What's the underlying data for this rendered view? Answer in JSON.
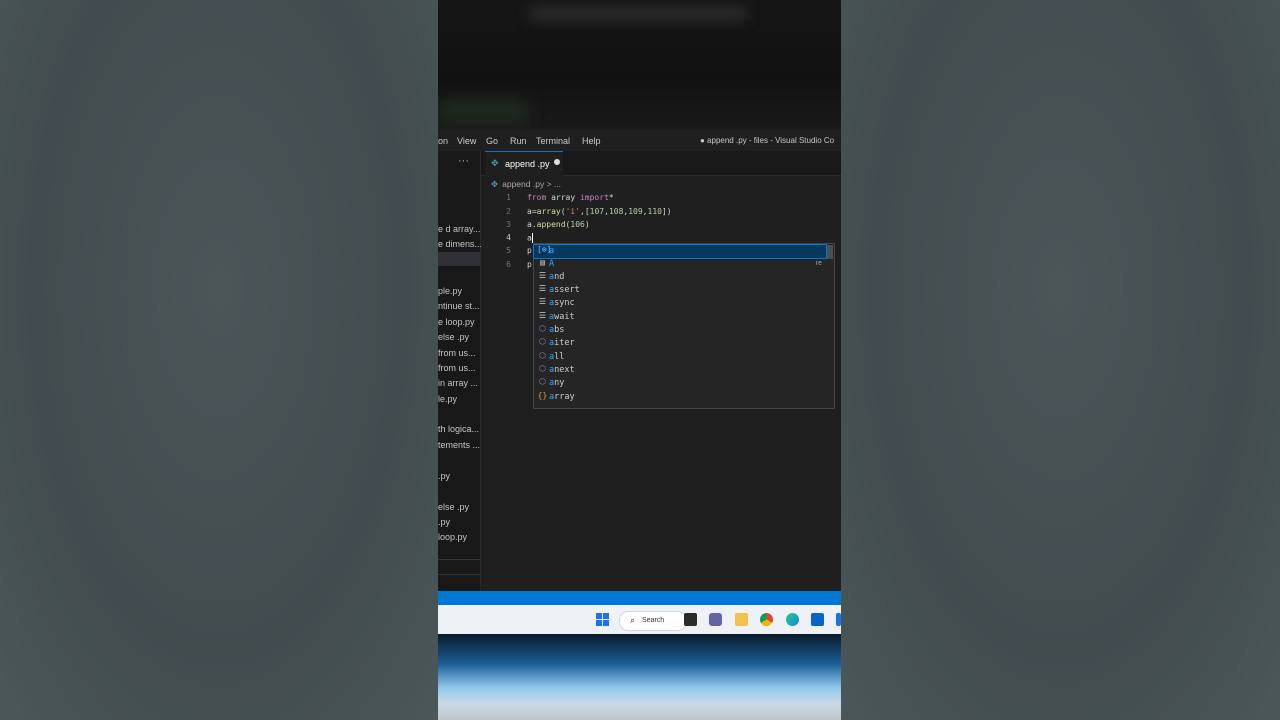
{
  "menubar": {
    "items": [
      "on",
      "View",
      "Go",
      "Run",
      "Terminal",
      "Help"
    ],
    "window_title": "● append .py - files - Visual Studio Co"
  },
  "explorer": {
    "more_label": "···",
    "files": [
      "e d array...",
      "e dimens...",
      "ple.py",
      "ntinue st...",
      "e loop.py",
      "else .py",
      "from us...",
      "from us...",
      "in array ...",
      "le.py",
      "th logica...",
      "tements ...",
      ".py",
      "else .py",
      ".py",
      "loop.py"
    ]
  },
  "tab": {
    "label": "append .py",
    "modified": true
  },
  "breadcrumb": {
    "file": "append .py",
    "separator": ">",
    "more": "..."
  },
  "editor": {
    "line_numbers": [
      "1",
      "2",
      "3",
      "4",
      "5",
      "6"
    ],
    "current_line": "4",
    "lines": [
      "from array import*",
      "a=array('i',[107,108,109,110])",
      "a.append(106)",
      "a",
      "p",
      "p"
    ]
  },
  "suggestions": {
    "items": [
      {
        "icon": "variable-icon",
        "label": "a",
        "detail": ""
      },
      {
        "icon": "class-icon",
        "label": "A",
        "detail": "re"
      },
      {
        "icon": "keyword-icon",
        "label": "and",
        "detail": ""
      },
      {
        "icon": "keyword-icon",
        "label": "assert",
        "detail": ""
      },
      {
        "icon": "keyword-icon",
        "label": "async",
        "detail": ""
      },
      {
        "icon": "keyword-icon",
        "label": "await",
        "detail": ""
      },
      {
        "icon": "function-icon",
        "label": "abs",
        "detail": ""
      },
      {
        "icon": "function-icon",
        "label": "aiter",
        "detail": ""
      },
      {
        "icon": "function-icon",
        "label": "all",
        "detail": ""
      },
      {
        "icon": "function-icon",
        "label": "anext",
        "detail": ""
      },
      {
        "icon": "function-icon",
        "label": "any",
        "detail": ""
      },
      {
        "icon": "module-icon",
        "label": "array",
        "detail": ""
      }
    ]
  },
  "taskbar": {
    "search_label": "Search"
  },
  "colors": {
    "editor_bg": "#1f1f1f",
    "accent": "#0078d4",
    "suggest_highlight": "#2aaaff"
  }
}
